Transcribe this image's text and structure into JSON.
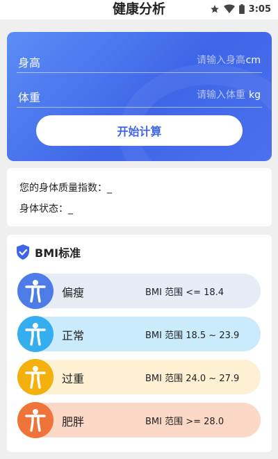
{
  "header": {
    "title": "健康分析"
  },
  "status_bar": {
    "time": "3:05",
    "icons": [
      "star-icon",
      "wifi-icon",
      "battery-icon"
    ]
  },
  "input_card": {
    "height": {
      "label": "身高",
      "placeholder": "请输入身高",
      "unit": "cm"
    },
    "weight": {
      "label": "体重",
      "placeholder": "请输入体重",
      "unit": "kg"
    },
    "calculate_label": "开始计算"
  },
  "result": {
    "bmi_label": "您的身体质量指数：",
    "bmi_value": "_",
    "status_label": "身体状态：",
    "status_value": "_"
  },
  "standard": {
    "title": "BMI标准",
    "items": [
      {
        "name": "偏瘦",
        "range": "BMI 范围 <= 18.4",
        "color": "#4d7ce8",
        "bg": "#e7edf7"
      },
      {
        "name": "正常",
        "range": "BMI 范围 18.5 ~ 23.9",
        "color": "#35aef0",
        "bg": "#c9ebfb"
      },
      {
        "name": "过重",
        "range": "BMI 范围 24.0 ~ 27.9",
        "color": "#f4b00d",
        "bg": "#fdf0d3"
      },
      {
        "name": "肥胖",
        "range": "BMI 范围 >= 28.0",
        "color": "#f0743a",
        "bg": "#fcd9c7"
      }
    ]
  },
  "colors": {
    "accent": "#3f66e8",
    "background": "#efefef"
  }
}
